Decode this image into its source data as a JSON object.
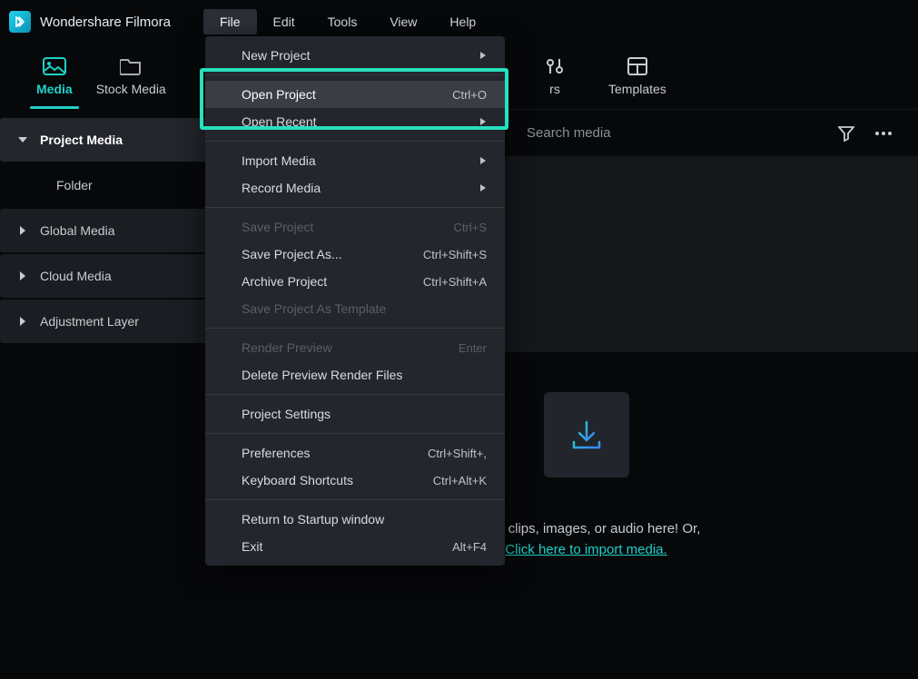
{
  "app": {
    "name": "Wondershare Filmora"
  },
  "menubar": [
    "File",
    "Edit",
    "Tools",
    "View",
    "Help"
  ],
  "tabs": {
    "media": {
      "label": "Media"
    },
    "stockMedia": {
      "label": "Stock Media"
    }
  },
  "rightTabs": {
    "effects": {
      "label": "rs"
    },
    "templates": {
      "label": "Templates"
    }
  },
  "sidebar": {
    "projectMedia": {
      "label": "Project Media"
    },
    "folder": {
      "label": "Folder"
    },
    "globalMedia": {
      "label": "Global Media"
    },
    "cloudMedia": {
      "label": "Cloud Media"
    },
    "adjustmentLayer": {
      "label": "Adjustment Layer"
    }
  },
  "search": {
    "placeholder": "Search media"
  },
  "dropzone": {
    "text": "video clips, images, or audio here! Or,",
    "link": "Click here to import media."
  },
  "fileMenu": {
    "newProject": {
      "label": "New Project"
    },
    "openProject": {
      "label": "Open Project",
      "shortcut": "Ctrl+O"
    },
    "openRecent": {
      "label": "Open Recent"
    },
    "importMedia": {
      "label": "Import Media"
    },
    "recordMedia": {
      "label": "Record Media"
    },
    "saveProject": {
      "label": "Save Project",
      "shortcut": "Ctrl+S"
    },
    "saveProjectAs": {
      "label": "Save Project As...",
      "shortcut": "Ctrl+Shift+S"
    },
    "archiveProject": {
      "label": "Archive Project",
      "shortcut": "Ctrl+Shift+A"
    },
    "saveAsTemplate": {
      "label": "Save Project As Template"
    },
    "renderPreview": {
      "label": "Render Preview",
      "shortcut": "Enter"
    },
    "deletePreview": {
      "label": "Delete Preview Render Files"
    },
    "projectSettings": {
      "label": "Project Settings"
    },
    "preferences": {
      "label": "Preferences",
      "shortcut": "Ctrl+Shift+,"
    },
    "keyboardShortcuts": {
      "label": "Keyboard Shortcuts",
      "shortcut": "Ctrl+Alt+K"
    },
    "returnStartup": {
      "label": "Return to Startup window"
    },
    "exit": {
      "label": "Exit",
      "shortcut": "Alt+F4"
    }
  }
}
